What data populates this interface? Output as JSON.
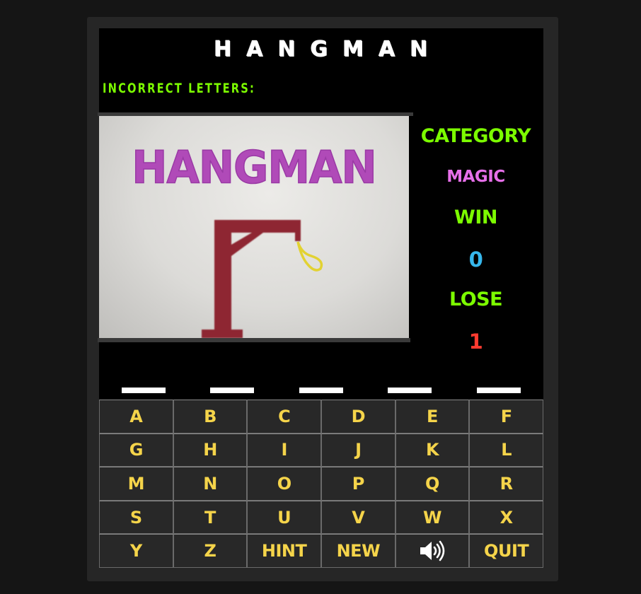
{
  "game": {
    "title": "HANGMAN",
    "incorrect_label": "INCORRECT LETTERS:",
    "incorrect_letters": ""
  },
  "picture": {
    "banner_text": "HANGMAN",
    "banner_color": "#b04ab8",
    "gallows_color": "#8e2630",
    "noose_color": "#e2d232",
    "body_parts_shown": 0
  },
  "stats": {
    "category_label": "CATEGORY",
    "category_value": "MAGIC",
    "win_label": "WIN",
    "win_value": "0",
    "lose_label": "LOSE",
    "lose_value": "1"
  },
  "word": {
    "length": 5,
    "revealed": [
      "",
      "",
      "",
      "",
      ""
    ]
  },
  "keyboard": {
    "keys": [
      "A",
      "B",
      "C",
      "D",
      "E",
      "F",
      "G",
      "H",
      "I",
      "J",
      "K",
      "L",
      "M",
      "N",
      "O",
      "P",
      "Q",
      "R",
      "S",
      "T",
      "U",
      "V",
      "W",
      "X",
      "Y",
      "Z",
      "HINT",
      "NEW",
      "sound-icon",
      "QUIT"
    ]
  },
  "colors": {
    "label_green": "#7cfc00",
    "magic_pink": "#e66fe9",
    "win_blue": "#36b7ec",
    "lose_red": "#ff3b30",
    "key_yellow": "#f5d44a"
  }
}
